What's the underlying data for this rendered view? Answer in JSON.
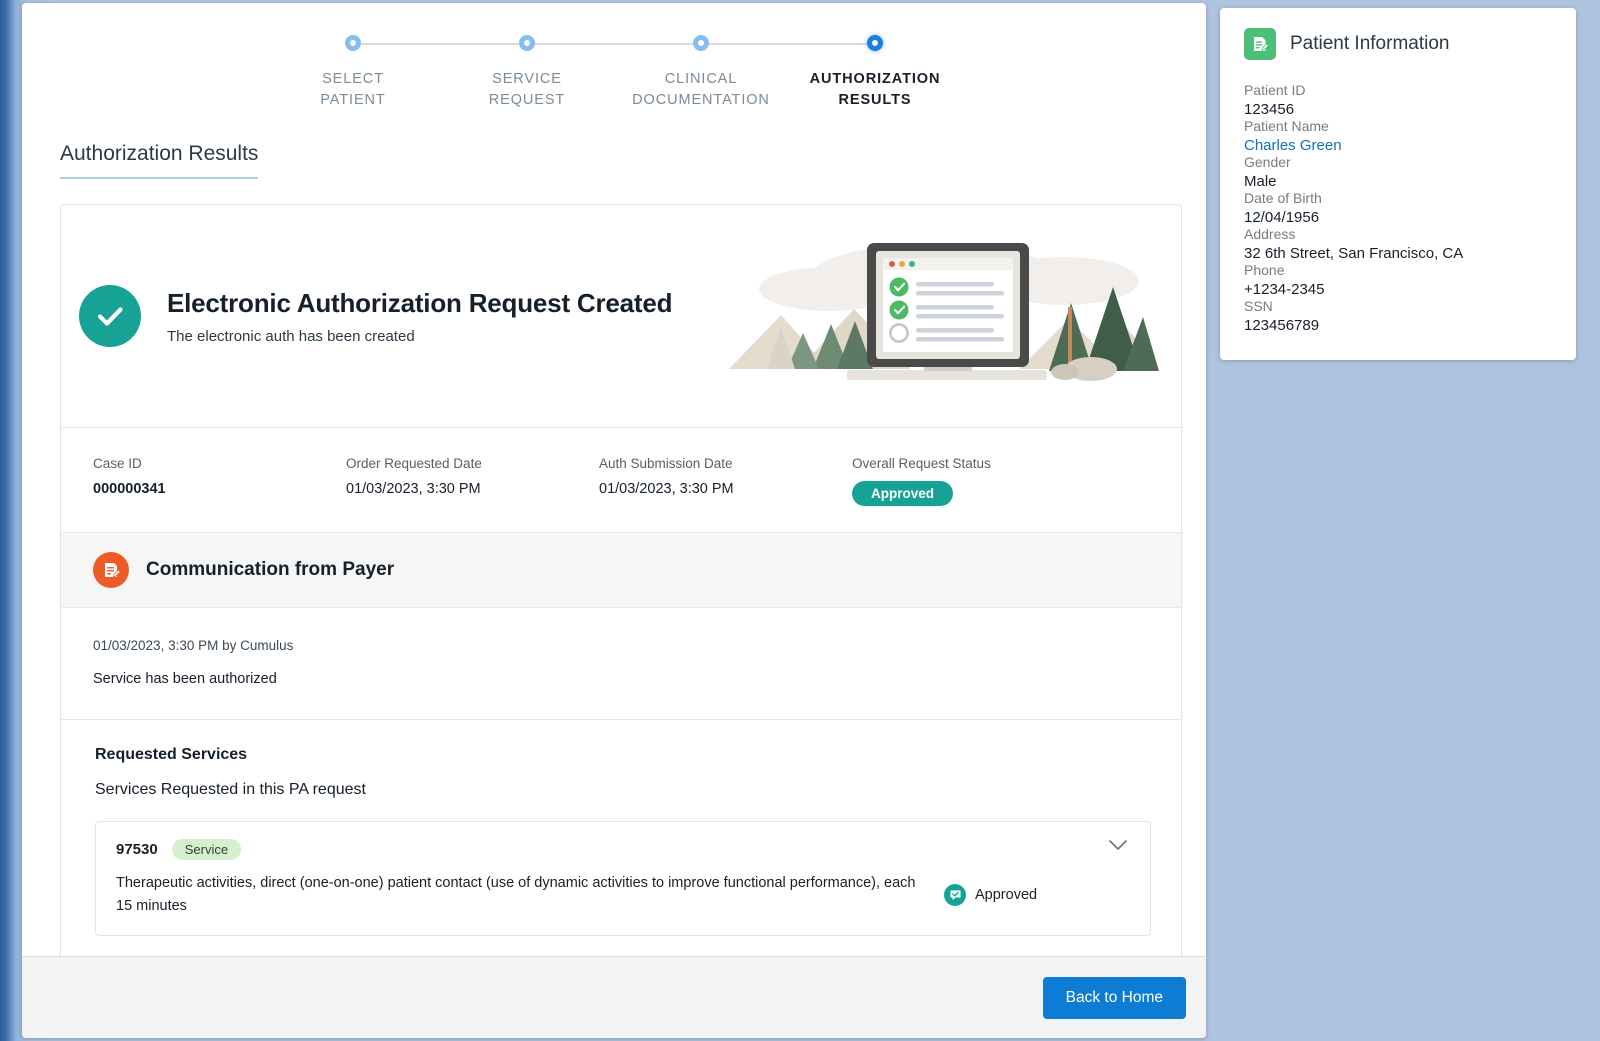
{
  "progress": {
    "steps": [
      {
        "label": "SELECT\nPATIENT",
        "state": "done"
      },
      {
        "label": "SERVICE\nREQUEST",
        "state": "done"
      },
      {
        "label": "CLINICAL\nDOCUMENTATION",
        "state": "done"
      },
      {
        "label": "AUTHORIZATION\nRESULTS",
        "state": "active"
      }
    ]
  },
  "page": {
    "title": "Authorization Results"
  },
  "hero": {
    "title": "Electronic Authorization Request Created",
    "subtitle": "The electronic auth has been created",
    "check_icon": "check-circle-icon",
    "illustration": "laptop-checklist-landscape-illustration"
  },
  "meta": {
    "fields": [
      {
        "label": "Case ID",
        "value": "000000341",
        "style": "bold"
      },
      {
        "label": "Order Requested Date",
        "value": "01/03/2023, 3:30 PM",
        "style": "normal"
      },
      {
        "label": "Auth Submission Date",
        "value": "01/03/2023, 3:30 PM",
        "style": "normal"
      },
      {
        "label": "Overall Request Status",
        "value": "Approved",
        "style": "pill"
      }
    ]
  },
  "payer": {
    "section_title": "Communication from Payer",
    "icon": "note-document-icon",
    "message_meta": "01/03/2023, 3:30 PM by Cumulus",
    "message_body": "Service has been authorized"
  },
  "requested_services": {
    "title": "Requested Services",
    "subtitle": "Services Requested in this PA request",
    "items": [
      {
        "code": "97530",
        "type_badge": "Service",
        "description": "Therapeutic activities, direct (one-on-one) patient contact (use of dynamic activities to improve functional performance), each 15 minutes",
        "status": "Approved",
        "status_icon": "approved-check-icon",
        "expander_icon": "chevron-down-icon"
      }
    ]
  },
  "footer": {
    "back_home_label": "Back to Home"
  },
  "patient": {
    "panel_title": "Patient Information",
    "icon": "patient-document-icon",
    "fields": [
      {
        "label": "Patient ID",
        "value": "123456",
        "kind": "text"
      },
      {
        "label": "Patient Name",
        "value": "Charles Green",
        "kind": "link"
      },
      {
        "label": "Gender",
        "value": "Male",
        "kind": "text"
      },
      {
        "label": "Date of Birth",
        "value": "12/04/1956",
        "kind": "text"
      },
      {
        "label": "Address",
        "value": "32 6th Street, San Francisco, CA",
        "kind": "text"
      },
      {
        "label": "Phone",
        "value": "+1234-2345",
        "kind": "text"
      },
      {
        "label": "SSN",
        "value": "123456789",
        "kind": "text"
      }
    ]
  },
  "colors": {
    "accent_blue": "#0d7cd4",
    "step_active": "#1d7fe0",
    "step_done": "#85bdf0",
    "success_teal": "#16a396",
    "payer_orange": "#ef5b28",
    "patient_green": "#4bc076",
    "badge_green": "#d6f0ce",
    "page_background": "#aec3e0"
  }
}
